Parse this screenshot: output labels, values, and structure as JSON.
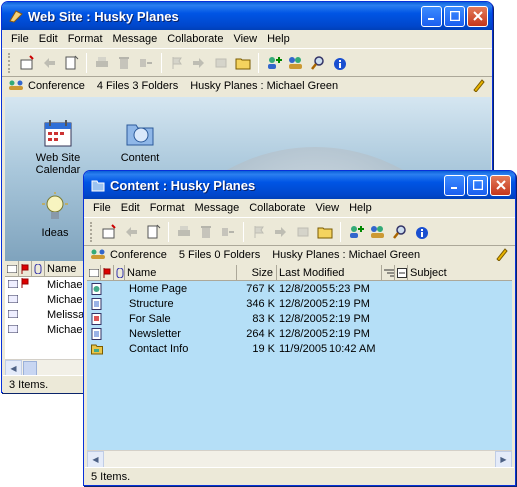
{
  "back": {
    "title": "Web Site : Husky Planes",
    "menu": [
      "File",
      "Edit",
      "Format",
      "Message",
      "Collaborate",
      "View",
      "Help"
    ],
    "status_line": {
      "label": "Conference",
      "files": "4 Files",
      "folders": "3 Folders",
      "path": "Husky Planes : Michael Green"
    },
    "icons": [
      {
        "label": "Web Site Calendar",
        "icon": "calendar-icon"
      },
      {
        "label": "Content",
        "icon": "content-folder-icon"
      },
      {
        "label": "Ideas",
        "icon": "lightbulb-icon"
      }
    ],
    "list_header": {
      "name": "Name"
    },
    "rows": [
      {
        "name": "Michael",
        "flag": true
      },
      {
        "name": "Michael",
        "flag": false
      },
      {
        "name": "Melissa",
        "flag": false
      },
      {
        "name": "Michael",
        "flag": false
      }
    ],
    "status": "3 Items."
  },
  "front": {
    "title": "Content : Husky Planes",
    "menu": [
      "File",
      "Edit",
      "Format",
      "Message",
      "Collaborate",
      "View",
      "Help"
    ],
    "status_line": {
      "label": "Conference",
      "files": "5 Files",
      "folders": "0 Folders",
      "path": "Husky Planes : Michael Green"
    },
    "columns": {
      "name": "Name",
      "size": "Size",
      "modified": "Last Modified",
      "subject": "Subject"
    },
    "rows": [
      {
        "name": "Home Page",
        "size": "767 K",
        "date": "12/8/2005",
        "time": "5:23 PM",
        "icon": "web-document-icon"
      },
      {
        "name": "Structure",
        "size": "346 K",
        "date": "12/8/2005",
        "time": "2:19 PM",
        "icon": "document-icon"
      },
      {
        "name": "For Sale",
        "size": "83 K",
        "date": "12/8/2005",
        "time": "2:19 PM",
        "icon": "image-document-icon"
      },
      {
        "name": "Newsletter",
        "size": "264 K",
        "date": "12/8/2005",
        "time": "2:19 PM",
        "icon": "document-icon"
      },
      {
        "name": "Contact Info",
        "size": "19 K",
        "date": "11/9/2005",
        "time": "10:42 AM",
        "icon": "folder-document-icon"
      }
    ],
    "status": "5 Items."
  },
  "colors": {
    "list_bg": "#b5dff7",
    "titlebar": "#0055e5",
    "close": "#c4361b"
  }
}
